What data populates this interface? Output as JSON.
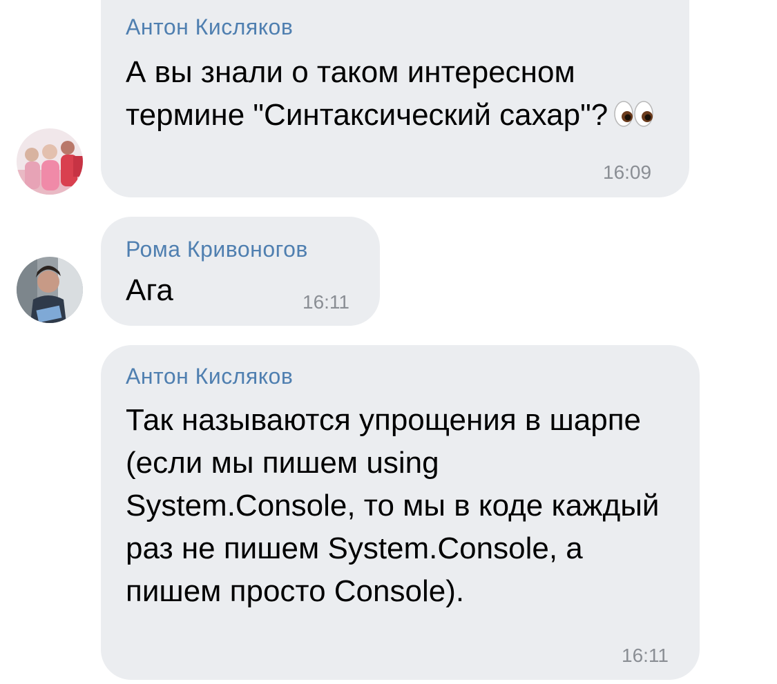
{
  "messages": [
    {
      "author": "Антон Кисляков",
      "text": "А вы знали о таком интересном термине \"Синтаксический сахар\"?",
      "emoji": "eyes-emoji",
      "time": "16:09",
      "avatar": "group-photo-avatar"
    },
    {
      "author": "Рома Кривоногов",
      "text": "Ага",
      "time": "16:11",
      "avatar": "user-photo-avatar"
    },
    {
      "author": "Антон Кисляков",
      "text": "Так называются упрощения в шарпе (если мы пишем using System.Console, то мы в коде каждый раз не пишем System.Console, а пишем просто Console).",
      "time": "16:11"
    }
  ],
  "colors": {
    "bubble": "#ebedf0",
    "author": "#4f7fb0",
    "time": "#8a8e94",
    "text": "#000000"
  }
}
